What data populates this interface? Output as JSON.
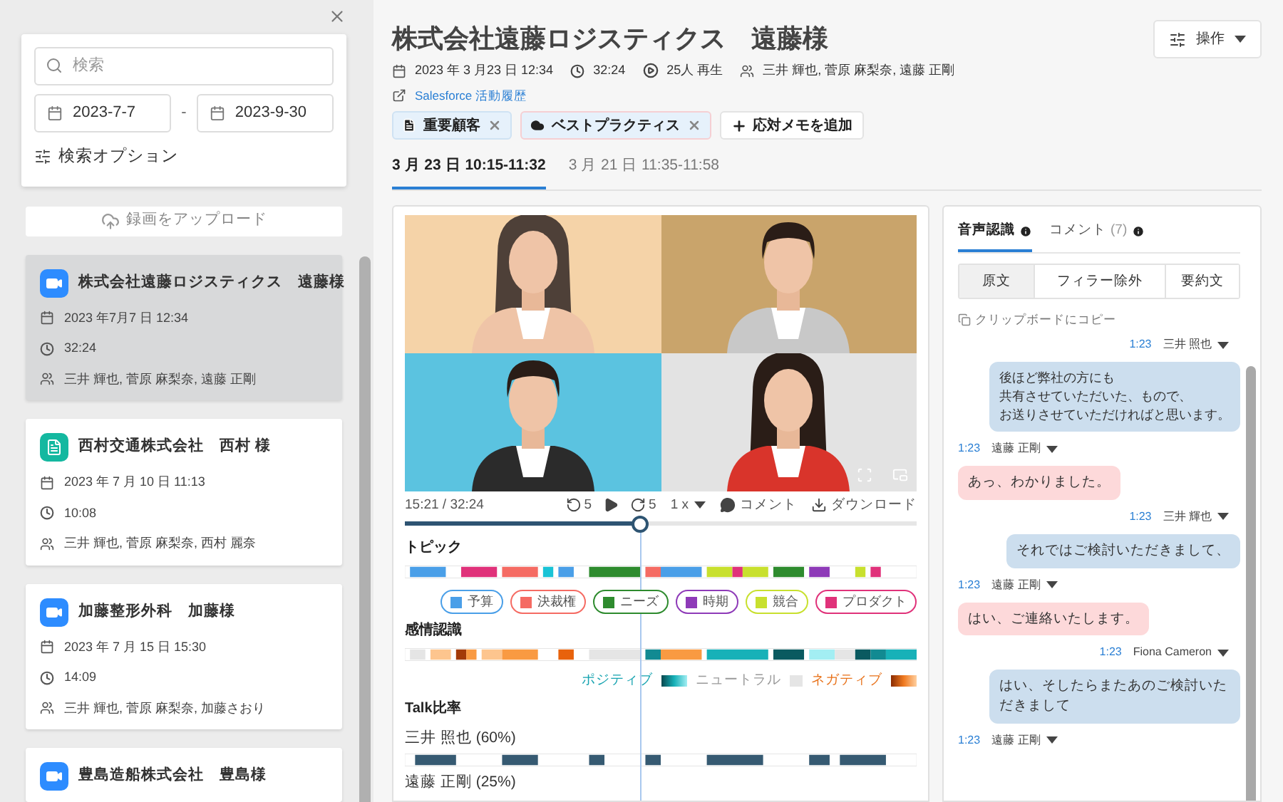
{
  "sidebar": {
    "search": {
      "placeholder": "検索"
    },
    "date_from": "2023-7-7",
    "date_separator": "-",
    "date_to": "2023-9-30",
    "options_label": "検索オプション",
    "upload_label": "録画をアップロード",
    "meetings": [
      {
        "kind": "video",
        "title": "株式会社遠藤ロジスティクス　遠藤様",
        "date": "2023 年7月7 日 12:34",
        "duration": "32:24",
        "participants": "三井 輝也, 菅原 麻梨奈, 遠藤 正剛",
        "selected": true
      },
      {
        "kind": "document",
        "title": "西村交通株式会社　西村 様",
        "date": "2023 年 7 月 10 日 11:13",
        "duration": "10:08",
        "participants": "三井 輝也, 菅原 麻梨奈, 西村 麗奈",
        "selected": false
      },
      {
        "kind": "video",
        "title": "加藤整形外科　加藤様",
        "date": "2023 年 7 月 15 日 15:30",
        "duration": "14:09",
        "participants": "三井 輝也, 菅原 麻梨奈, 加藤さおり",
        "selected": false
      },
      {
        "kind": "video",
        "title": "豊島造船株式会社　豊島様",
        "selected": false
      }
    ]
  },
  "header": {
    "title": "株式会社遠藤ロジスティクス　遠藤様",
    "date": "2023 年 3 月23 日 12:34",
    "duration": "32:24",
    "plays": "25人 再生",
    "participants": "三井 輝也, 菅原 麻梨奈, 遠藤 正剛",
    "link": "Salesforce 活動履歴",
    "actions_label": "操作",
    "tags": [
      {
        "kind": "document",
        "label": "重要顧客"
      },
      {
        "kind": "cloud",
        "label": "ベストプラクティス"
      }
    ],
    "add_memo_label": "応対メモを追加"
  },
  "session_tabs": [
    {
      "label": "3 月 23 日 10:15-11:32",
      "selected": true
    },
    {
      "label": "3 月 21 日 11:35-11:58",
      "selected": false
    }
  ],
  "player": {
    "time": "15:21 / 32:24",
    "back": "5",
    "forward": "5",
    "speed": "1 x",
    "comment": "コメント",
    "download": "ダウンロード",
    "level": 0.46
  },
  "topics": {
    "title": "トピック",
    "legend": [
      {
        "label": "予算",
        "color": "#4a9fe8"
      },
      {
        "label": "決裁権",
        "color": "#f56b63"
      },
      {
        "label": "ニーズ",
        "color": "#2e8b2e"
      },
      {
        "label": "時期",
        "color": "#8e3ab8"
      },
      {
        "label": "競合",
        "color": "#c8e02e"
      },
      {
        "label": "プロダクト",
        "color": "#e0327a"
      }
    ]
  },
  "sentiment": {
    "title": "感情認識",
    "legend": [
      {
        "kind": "positive",
        "label": "ポジティブ",
        "color": "#16a3b0"
      },
      {
        "kind": "neutral",
        "label": "ニュートラル",
        "color": "#9a9a9a"
      },
      {
        "kind": "negative",
        "label": "ネガティブ",
        "color": "#e8731c"
      }
    ]
  },
  "talk": {
    "title": "Talk比率",
    "speakers": [
      {
        "label": "三井 照也 (60%)"
      },
      {
        "label": "遠藤 正剛 (25%)"
      }
    ]
  },
  "transcript": {
    "tabs": [
      {
        "label": "音声認識",
        "selected": true
      },
      {
        "label": "コメント",
        "count": "(7)",
        "selected": false
      }
    ],
    "modes": [
      {
        "label": "原文",
        "selected": true
      },
      {
        "label": "フィラー除外",
        "selected": false
      },
      {
        "label": "要約文",
        "selected": false
      }
    ],
    "copy_label": "クリップボードにコピー",
    "messages": [
      {
        "kind": "outgoing",
        "time": "1:23",
        "speaker": "三井 照也",
        "lines": [
          "後ほど弊社の方にも",
          "共有させていただいた、もので、",
          "お送りさせていただければと思います。"
        ]
      },
      {
        "kind": "incoming",
        "time": "1:23",
        "speaker": "遠藤 正剛",
        "text": "あっ、わかりました。"
      },
      {
        "kind": "outgoing",
        "time": "1:23",
        "speaker": "三井 輝也",
        "text": "それではご検討いただきまして、"
      },
      {
        "kind": "incoming",
        "time": "1:23",
        "speaker": "遠藤 正剛",
        "text": "はい、ご連絡いたします。"
      },
      {
        "kind": "outgoing",
        "time": "1:23",
        "speaker": "Fiona Cameron",
        "text": "はい、そしたらまたあのご検討いただきまして"
      },
      {
        "kind": "incoming",
        "time": "1:23",
        "speaker": "遠藤 正剛"
      }
    ]
  }
}
